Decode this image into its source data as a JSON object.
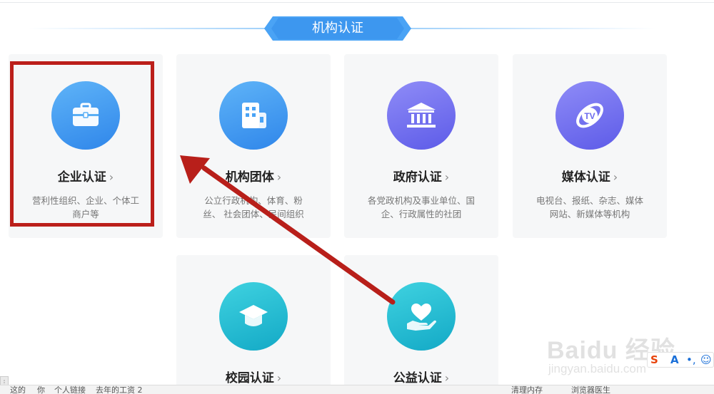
{
  "header": {
    "title": "机构认证"
  },
  "cards": [
    {
      "title": "企业认证",
      "chevron": "›",
      "desc": "营利性组织、企业、个体工商户等",
      "icon": "briefcase-icon",
      "color": "#3d97ef"
    },
    {
      "title": "机构团体",
      "chevron": "›",
      "desc": "公立行政机构、体育、粉丝、 社会团体、民间组织",
      "icon": "building-icon",
      "color": "#3d97ef"
    },
    {
      "title": "政府认证",
      "chevron": "›",
      "desc": "各党政机构及事业单位、国企、行政属性的社团",
      "icon": "government-building-icon",
      "color": "#6c6aee"
    },
    {
      "title": "媒体认证",
      "chevron": "›",
      "desc": "电视台、报纸、杂志、媒体 网站、新媒体等机构",
      "icon": "tv-icon",
      "color": "#6c6aee"
    },
    {
      "title": "校园认证",
      "chevron": "›",
      "icon": "graduation-cap-icon",
      "color": "#1eb8cf"
    },
    {
      "title": "公益认证",
      "chevron": "›",
      "icon": "heart-hand-icon",
      "color": "#1eb8cf"
    }
  ],
  "annotation": {
    "highlight_color": "#bb1f1a"
  },
  "bottom_bar": {
    "left_items": [
      "这的",
      "你",
      "个人链接",
      "去年的工资 2"
    ],
    "right_items": [
      "清理内存",
      "浏览器医生"
    ]
  },
  "watermark": {
    "brand": "Baidu 经验",
    "sub": "jingyan.baidu.com"
  },
  "ime": {
    "s": "S",
    "a": "A",
    "dot": "•,",
    "emoji": "☺"
  }
}
